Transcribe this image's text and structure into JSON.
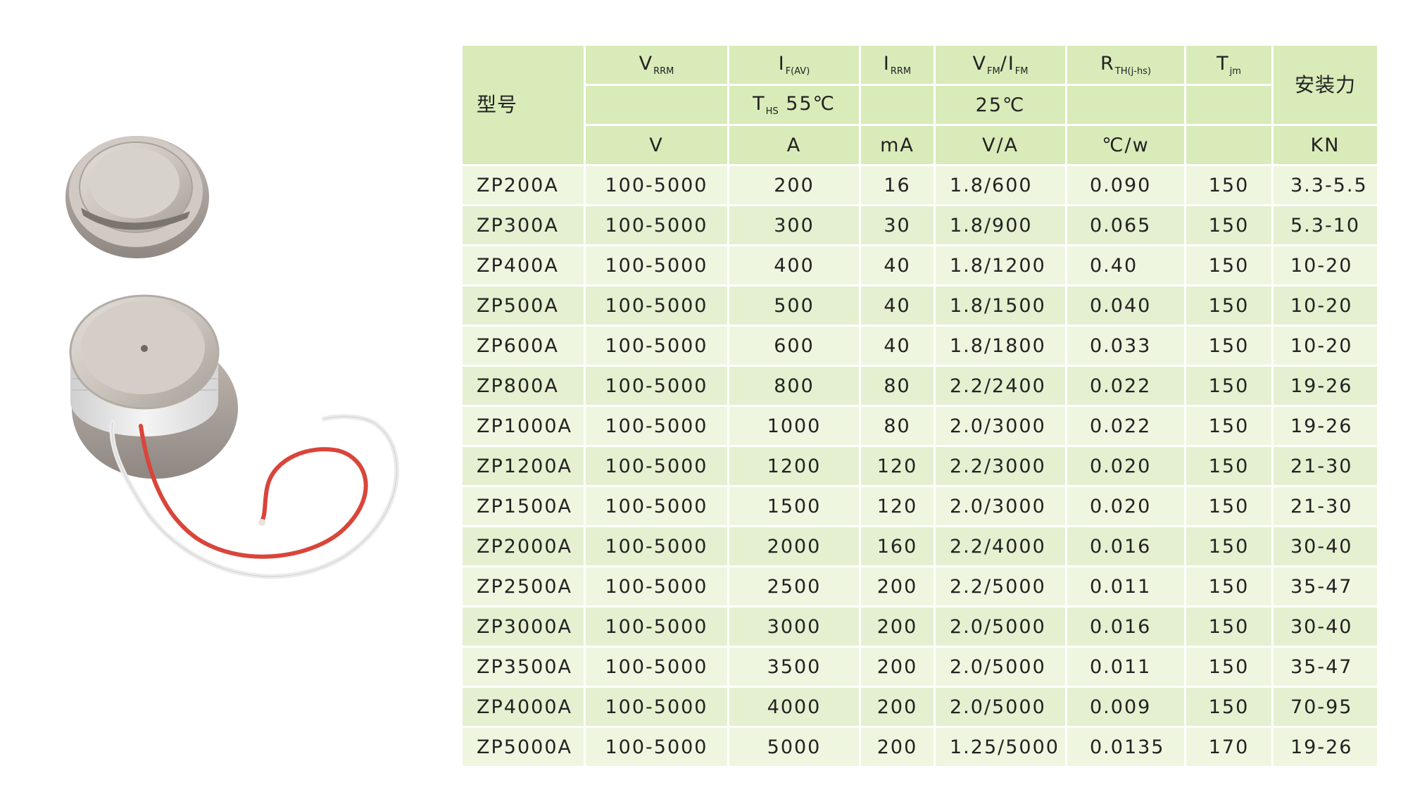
{
  "table": {
    "model_header": "型号",
    "params": {
      "vrrm": {
        "main": "V",
        "sub": "RRM"
      },
      "ifav": {
        "main": "I",
        "sub": "F(AV)"
      },
      "irrm": {
        "main": "I",
        "sub": "RRM"
      },
      "vfm": {
        "main1": "V",
        "sub1": "FM",
        "sep": "/",
        "main2": "I",
        "sub2": "FM"
      },
      "rth": {
        "main": "R",
        "sub": "TH(j-hs)"
      },
      "tjm": {
        "main": "T",
        "sub": "jm"
      }
    },
    "force_header": "安装力",
    "conditions": {
      "ths": {
        "main": "T",
        "sub": "HS",
        "value": "55℃"
      },
      "vf_temp": "25℃"
    },
    "units": {
      "vrrm": "V",
      "ifav": "A",
      "irrm": "mA",
      "vfm": "V/A",
      "rth": "℃/w",
      "tjm": "",
      "force": "KN"
    },
    "rows": [
      {
        "model": "ZP200A",
        "vrrm": "100-5000",
        "ifav": "200",
        "irrm": "16",
        "vfm": "1.8/600",
        "rth": "0.090",
        "tjm": "150",
        "force": "3.3-5.5"
      },
      {
        "model": "ZP300A",
        "vrrm": "100-5000",
        "ifav": "300",
        "irrm": "30",
        "vfm": "1.8/900",
        "rth": "0.065",
        "tjm": "150",
        "force": "5.3-10"
      },
      {
        "model": "ZP400A",
        "vrrm": "100-5000",
        "ifav": "400",
        "irrm": "40",
        "vfm": "1.8/1200",
        "rth": "0.40",
        "tjm": "150",
        "force": "10-20"
      },
      {
        "model": "ZP500A",
        "vrrm": "100-5000",
        "ifav": "500",
        "irrm": "40",
        "vfm": "1.8/1500",
        "rth": "0.040",
        "tjm": "150",
        "force": "10-20"
      },
      {
        "model": "ZP600A",
        "vrrm": "100-5000",
        "ifav": "600",
        "irrm": "40",
        "vfm": "1.8/1800",
        "rth": "0.033",
        "tjm": "150",
        "force": "10-20"
      },
      {
        "model": "ZP800A",
        "vrrm": "100-5000",
        "ifav": "800",
        "irrm": "80",
        "vfm": "2.2/2400",
        "rth": "0.022",
        "tjm": "150",
        "force": "19-26"
      },
      {
        "model": "ZP1000A",
        "vrrm": "100-5000",
        "ifav": "1000",
        "irrm": "80",
        "vfm": "2.0/3000",
        "rth": "0.022",
        "tjm": "150",
        "force": "19-26"
      },
      {
        "model": "ZP1200A",
        "vrrm": "100-5000",
        "ifav": "1200",
        "irrm": "120",
        "vfm": "2.2/3000",
        "rth": "0.020",
        "tjm": "150",
        "force": "21-30"
      },
      {
        "model": "ZP1500A",
        "vrrm": "100-5000",
        "ifav": "1500",
        "irrm": "120",
        "vfm": "2.0/3000",
        "rth": "0.020",
        "tjm": "150",
        "force": "21-30"
      },
      {
        "model": "ZP2000A",
        "vrrm": "100-5000",
        "ifav": "2000",
        "irrm": "160",
        "vfm": "2.2/4000",
        "rth": "0.016",
        "tjm": "150",
        "force": "30-40"
      },
      {
        "model": "ZP2500A",
        "vrrm": "100-5000",
        "ifav": "2500",
        "irrm": "200",
        "vfm": "2.2/5000",
        "rth": "0.011",
        "tjm": "150",
        "force": "35-47"
      },
      {
        "model": "ZP3000A",
        "vrrm": "100-5000",
        "ifav": "3000",
        "irrm": "200",
        "vfm": "2.0/5000",
        "rth": "0.016",
        "tjm": "150",
        "force": "30-40"
      },
      {
        "model": "ZP3500A",
        "vrrm": "100-5000",
        "ifav": "3500",
        "irrm": "200",
        "vfm": "2.0/5000",
        "rth": "0.011",
        "tjm": "150",
        "force": "35-47"
      },
      {
        "model": "ZP4000A",
        "vrrm": "100-5000",
        "ifav": "4000",
        "irrm": "200",
        "vfm": "2.0/5000",
        "rth": "0.009",
        "tjm": "150",
        "force": "70-95"
      },
      {
        "model": "ZP5000A",
        "vrrm": "100-5000",
        "ifav": "5000",
        "irrm": "200",
        "vfm": "1.25/5000",
        "rth": "0.0135",
        "tjm": "170",
        "force": "19-26"
      }
    ]
  }
}
